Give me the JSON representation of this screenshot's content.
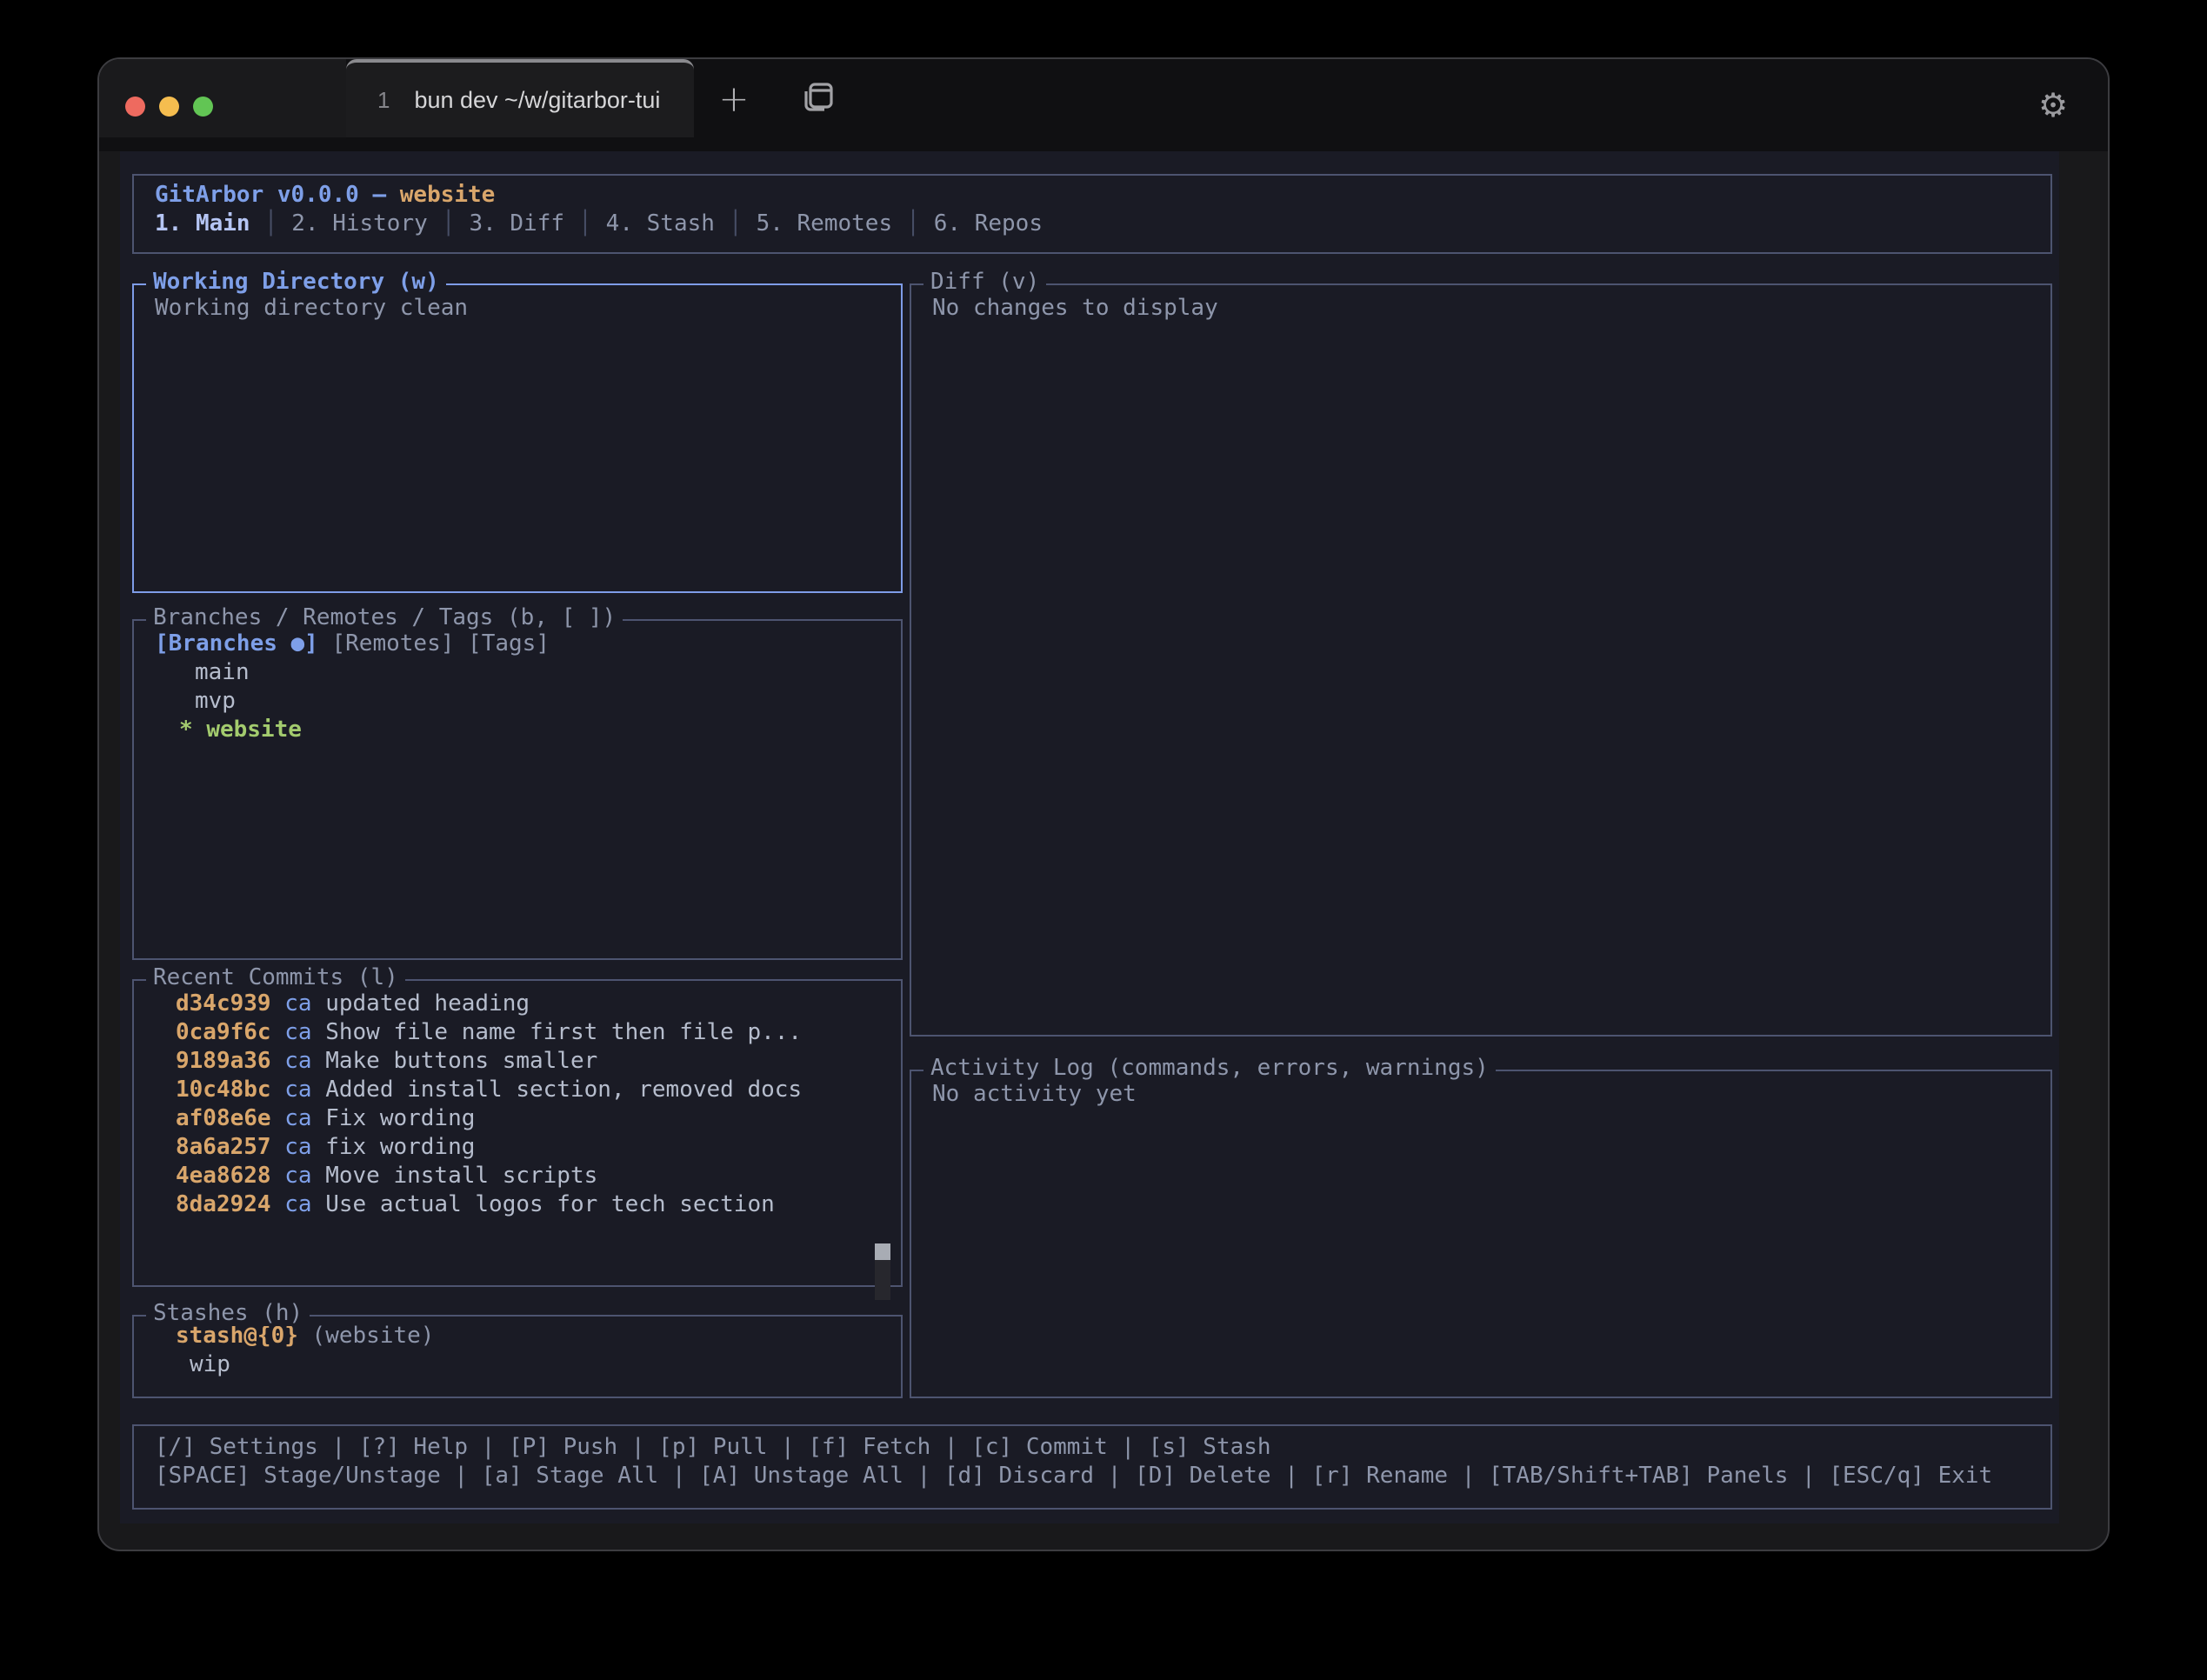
{
  "colors": {
    "chrome": "#19191b",
    "term_bg": "#1a1b25",
    "border": "#4d5470",
    "border_active": "#7e9ce8",
    "text_dim": "#8e96ab",
    "accent_blue": "#7e9fe8",
    "accent_tan": "#d9a66b",
    "accent_green": "#a3cb6e",
    "light_red": "#ee6a5f",
    "light_yellow": "#f5bd4f",
    "light_green": "#62c554"
  },
  "icons": {
    "plus": "+",
    "gear": "⚙"
  },
  "window": {
    "tab_number": "1",
    "tab_title": "bun dev ~/w/gitarbor-tui"
  },
  "header": {
    "app_title": "GitArbor v0.0.0 —",
    "branch": "website",
    "separator": "│",
    "tabs": [
      {
        "label": "1. Main",
        "active": true
      },
      {
        "label": "2. History",
        "active": false
      },
      {
        "label": "3. Diff",
        "active": false
      },
      {
        "label": "4. Stash",
        "active": false
      },
      {
        "label": "5. Remotes",
        "active": false
      },
      {
        "label": "6. Repos",
        "active": false
      }
    ]
  },
  "panels": {
    "working_directory": {
      "title": "Working Directory (w)",
      "content": "Working directory clean"
    },
    "diff": {
      "title": "Diff (v)",
      "content": "No changes to display"
    },
    "branches": {
      "title": "Branches / Remotes / Tags (b, [ ])",
      "filter_branches": "[Branches ●]",
      "filter_remotes": "[Remotes]",
      "filter_tags": "[Tags]",
      "items": [
        {
          "prefix": "",
          "name": "main",
          "current": false
        },
        {
          "prefix": "",
          "name": "mvp",
          "current": false
        },
        {
          "prefix": "*",
          "name": "website",
          "current": true
        }
      ]
    },
    "commits": {
      "title": "Recent Commits (l)",
      "items": [
        {
          "hash": "d34c939",
          "author": "ca",
          "message": "updated heading"
        },
        {
          "hash": "0ca9f6c",
          "author": "ca",
          "message": "Show file name first then file p..."
        },
        {
          "hash": "9189a36",
          "author": "ca",
          "message": "Make buttons smaller"
        },
        {
          "hash": "10c48bc",
          "author": "ca",
          "message": "Added install section, removed docs"
        },
        {
          "hash": "af08e6e",
          "author": "ca",
          "message": "Fix wording"
        },
        {
          "hash": "8a6a257",
          "author": "ca",
          "message": "fix wording"
        },
        {
          "hash": "4ea8628",
          "author": "ca",
          "message": "Move install scripts"
        },
        {
          "hash": "8da2924",
          "author": "ca",
          "message": "Use actual logos for tech section"
        }
      ]
    },
    "stashes": {
      "title": "Stashes (h)",
      "items": [
        {
          "ref": "stash@{0}",
          "branch_label": "(website)",
          "message": "wip"
        }
      ]
    },
    "activity": {
      "title": "Activity Log (commands, errors, warnings)",
      "content": "No activity yet"
    }
  },
  "keybar": {
    "line1": "[/] Settings | [?] Help | [P] Push | [p] Pull | [f] Fetch | [c] Commit | [s] Stash",
    "line2": "[SPACE] Stage/Unstage | [a] Stage All | [A] Unstage All | [d] Discard | [D] Delete | [r] Rename | [TAB/Shift+TAB] Panels | [ESC/q] Exit"
  }
}
